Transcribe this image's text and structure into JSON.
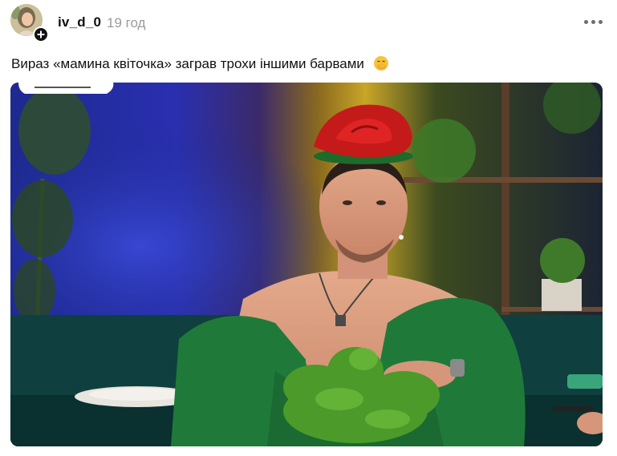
{
  "post": {
    "author": {
      "username": "iv_d_0",
      "avatar_icon": "profile-photo",
      "follow_icon": "plus-icon"
    },
    "timestamp": "19 год",
    "more_icon": "more-dots-icon",
    "caption": {
      "text": "Вираз «мамина квіточка» заграв трохи іншими барвами",
      "emoji": "face-with-hand-over-mouth-emoji"
    },
    "media": {
      "kind": "photo",
      "description_icon": "video-still-image"
    }
  },
  "colors": {
    "text_primary": "#111111",
    "text_secondary": "#9a9a9a",
    "badge_background": "#111111",
    "dots": "#6d6d6d"
  }
}
